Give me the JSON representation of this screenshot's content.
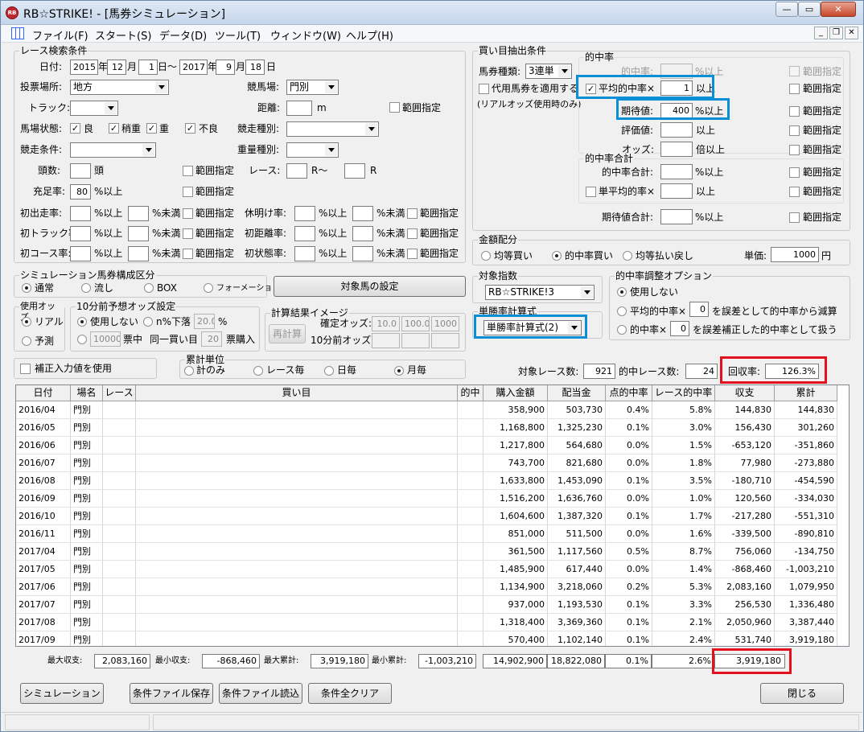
{
  "window": {
    "app_title": "RB☆STRIKE! - [馬券シミュレーション]",
    "min": "0",
    "max": "1",
    "close": "r"
  },
  "menu": [
    "ファイル(F)",
    "スタート(S)",
    "データ(D)",
    "ツール(T)",
    "ウィンドウ(W)",
    "ヘルプ(H)"
  ],
  "race": {
    "group": "レース検索条件",
    "date_label": "日付:",
    "y1": "2015",
    "nen1": "年",
    "m1": "12",
    "tsuki1": "月",
    "d1": "1",
    "hi1": "日～",
    "y2": "2017",
    "nen2": "年",
    "m2": "9",
    "tsuki2": "月",
    "d2": "18",
    "hi2": "日",
    "venue_label": "投票場所:",
    "venue": "地方",
    "course_label": "競馬場:",
    "course": "門別",
    "track_label": "トラック:",
    "track": "",
    "dist_label": "距離:",
    "dist_unit": "m",
    "range": "範囲指定",
    "cond_label": "馬場状態:",
    "cond": [
      "良",
      "稍重",
      "重",
      "不良"
    ],
    "race_type_label": "競走種別:",
    "race_cond_label": "競走条件:",
    "weight_label": "重量種別:",
    "heads_label": "頭数:",
    "heads_unit": "頭",
    "race_label": "レース:",
    "race_r1": "R～",
    "race_r2": "R",
    "fill_label": "充足率:",
    "fill_val": "80",
    "fill_unit": "%以上",
    "row_labels": [
      "初出走率:",
      "初トラック率:",
      "初コース率:"
    ],
    "row2_labels": [
      "休明け率:",
      "初距離率:",
      "初状態率:"
    ],
    "pct_over": "%以上",
    "pct_under": "%未満"
  },
  "bet": {
    "group": "買い目抽出条件",
    "type_label": "馬券種類:",
    "type": "3連単",
    "substitute": "代用馬券を適用する",
    "real_note": "(リアルオッズ使用時のみ)",
    "hit_group": "的中率",
    "hit_rate": "的中率:",
    "avg_hit": "平均的中率×",
    "avg_val": "1",
    "over": "以上",
    "pct_over": "%以上",
    "exp": "期待値:",
    "exp_val": "400",
    "eval": "評価値:",
    "odds": "オッズ:",
    "odds_unit": "倍以上",
    "range": "範囲指定",
    "sum_group": "的中率合計",
    "sum_hit": "的中率合計:",
    "single_avg": "単平均的率×",
    "exp_sum": "期待値合計:"
  },
  "money": {
    "group": "金額配分",
    "opts": [
      "均等買い",
      "的中率買い",
      "均等払い戻し"
    ],
    "unit_label": "単価:",
    "unit_val": "1000",
    "yen": "円"
  },
  "sim": {
    "group": "シミュレーション馬券構成区分",
    "opts": [
      "通常",
      "流し",
      "BOX",
      "フォーメーション"
    ],
    "target_btn": "対象馬の設定"
  },
  "index": {
    "group": "対象指数",
    "val": "RB☆STRIKE!3"
  },
  "adj": {
    "group": "的中率調整オプション",
    "opts": [
      "使用しない",
      "平均的中率×",
      "的中率×"
    ],
    "v1": "0",
    "t1": "を誤差として的中率から減算",
    "v2": "0",
    "t2": "を誤差補正した的中率として扱う"
  },
  "win": {
    "group": "単勝率計算式",
    "val": "単勝率計算式(2)"
  },
  "odds_use": {
    "group": "使用オッズ",
    "opts": [
      "リアル",
      "予測"
    ]
  },
  "pre10": {
    "group": "10分前予想オッズ設定",
    "opts": [
      "使用しない",
      "n%下落"
    ],
    "pct_val": "20.0",
    "pct": "%",
    "votes": "10000",
    "votes_unit": "票中",
    "same": "同一買い目",
    "buy_val": "20",
    "buy_unit": "票購入"
  },
  "calc": {
    "group": "計算結果イメージ",
    "recalc": "再計算",
    "fixed": "確定オッズ:",
    "pre": "10分前オッズ:",
    "f1": "10.0",
    "f2": "100.0",
    "f3": "1000"
  },
  "correct": {
    "label": "補正入力値を使用"
  },
  "agg": {
    "group": "累計単位",
    "opts": [
      "計のみ",
      "レース毎",
      "日毎",
      "月毎"
    ]
  },
  "stats": {
    "target_label": "対象レース数:",
    "target": "921",
    "hit_label": "的中レース数:",
    "hit": "24",
    "return_label": "回収率:",
    "return": "126.3%"
  },
  "table": {
    "headers": [
      "日付",
      "場名",
      "レース",
      "買い目",
      "的中",
      "購入金額",
      "配当金",
      "点的中率",
      "レース的中率",
      "収支",
      "累計"
    ],
    "rows": [
      [
        "2016/04",
        "門別",
        "",
        "",
        "",
        "358,900",
        "503,730",
        "0.4%",
        "5.8%",
        "144,830",
        "144,830"
      ],
      [
        "2016/05",
        "門別",
        "",
        "",
        "",
        "1,168,800",
        "1,325,230",
        "0.1%",
        "3.0%",
        "156,430",
        "301,260"
      ],
      [
        "2016/06",
        "門別",
        "",
        "",
        "",
        "1,217,800",
        "564,680",
        "0.0%",
        "1.5%",
        "-653,120",
        "-351,860"
      ],
      [
        "2016/07",
        "門別",
        "",
        "",
        "",
        "743,700",
        "821,680",
        "0.0%",
        "1.8%",
        "77,980",
        "-273,880"
      ],
      [
        "2016/08",
        "門別",
        "",
        "",
        "",
        "1,633,800",
        "1,453,090",
        "0.1%",
        "3.5%",
        "-180,710",
        "-454,590"
      ],
      [
        "2016/09",
        "門別",
        "",
        "",
        "",
        "1,516,200",
        "1,636,760",
        "0.0%",
        "1.0%",
        "120,560",
        "-334,030"
      ],
      [
        "2016/10",
        "門別",
        "",
        "",
        "",
        "1,604,600",
        "1,387,320",
        "0.1%",
        "1.7%",
        "-217,280",
        "-551,310"
      ],
      [
        "2016/11",
        "門別",
        "",
        "",
        "",
        "851,000",
        "511,500",
        "0.0%",
        "1.6%",
        "-339,500",
        "-890,810"
      ],
      [
        "2017/04",
        "門別",
        "",
        "",
        "",
        "361,500",
        "1,117,560",
        "0.5%",
        "8.7%",
        "756,060",
        "-134,750"
      ],
      [
        "2017/05",
        "門別",
        "",
        "",
        "",
        "1,485,900",
        "617,440",
        "0.0%",
        "1.4%",
        "-868,460",
        "-1,003,210"
      ],
      [
        "2017/06",
        "門別",
        "",
        "",
        "",
        "1,134,900",
        "3,218,060",
        "0.2%",
        "5.3%",
        "2,083,160",
        "1,079,950"
      ],
      [
        "2017/07",
        "門別",
        "",
        "",
        "",
        "937,000",
        "1,193,530",
        "0.1%",
        "3.3%",
        "256,530",
        "1,336,480"
      ],
      [
        "2017/08",
        "門別",
        "",
        "",
        "",
        "1,318,400",
        "3,369,360",
        "0.1%",
        "2.1%",
        "2,050,960",
        "3,387,440"
      ],
      [
        "2017/09",
        "門別",
        "",
        "",
        "",
        "570,400",
        "1,102,140",
        "0.1%",
        "2.4%",
        "531,740",
        "3,919,180"
      ]
    ]
  },
  "summary": {
    "max_income_label": "最大収支:",
    "max_income": "2,083,160",
    "min_income_label": "最小収支:",
    "min_income": "-868,460",
    "max_cum_label": "最大累計:",
    "max_cum": "3,919,180",
    "min_cum_label": "最小累計:",
    "min_cum": "-1,003,210",
    "total_buy": "14,902,900",
    "total_pay": "18,822,080",
    "pt_hit": "0.1%",
    "race_hit": "2.6%",
    "total_income": "3,919,180"
  },
  "buttons": {
    "simulate": "シミュレーション",
    "save": "条件ファイル保存",
    "load": "条件ファイル読込",
    "clear": "条件全クリア",
    "close": "閉じる"
  }
}
